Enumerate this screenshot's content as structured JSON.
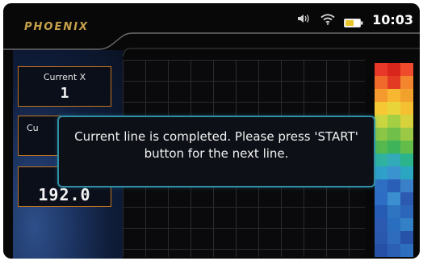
{
  "header": {
    "brand": "PHOENIX",
    "time": "10:03",
    "icons": [
      "volume-icon",
      "wifi-icon",
      "battery-icon"
    ]
  },
  "fields": [
    {
      "label": "Current X",
      "value": "1"
    },
    {
      "label": "Cu",
      "value": ""
    },
    {
      "label": "",
      "value": "192.0"
    }
  ],
  "dialog": {
    "message": "Current line is completed. Please press 'START' button for the next line."
  },
  "colors": {
    "accent_orange": "#c2741f",
    "dialog_border": "#2f8fa6",
    "brand_gold": "#c8a24a"
  }
}
